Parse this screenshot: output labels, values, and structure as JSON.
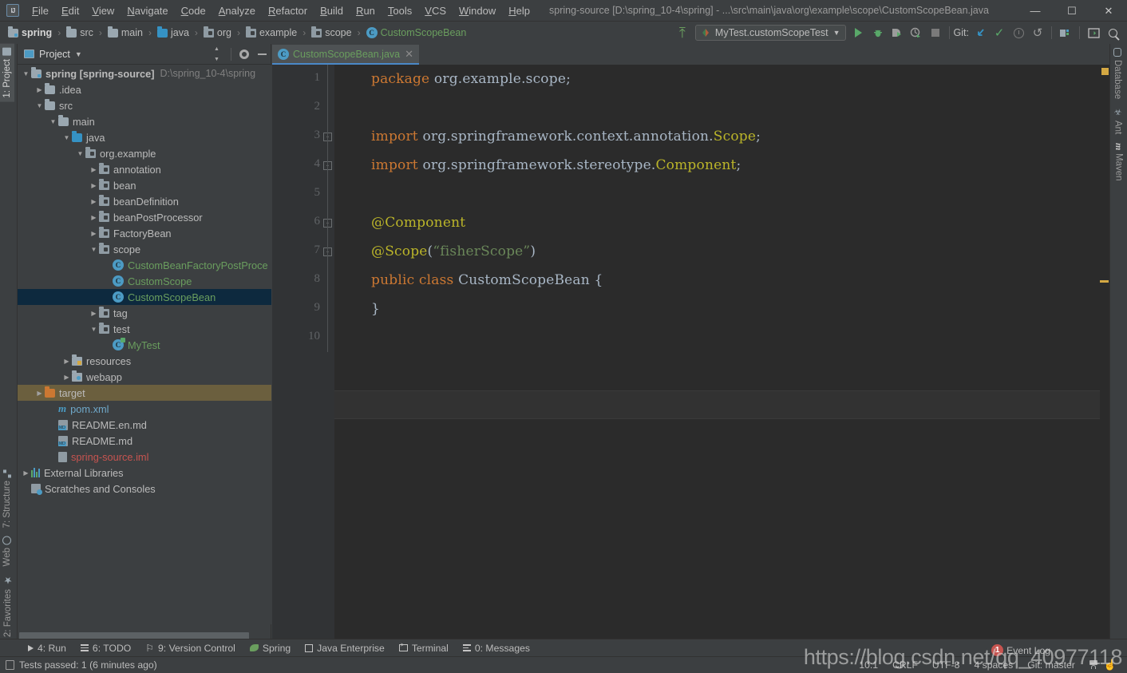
{
  "titlebar": {
    "logo": "IJ",
    "title": "spring-source [D:\\spring_10-4\\spring] - ...\\src\\main\\java\\org\\example\\scope\\CustomScopeBean.java",
    "menus": [
      {
        "label": "File"
      },
      {
        "label": "Edit"
      },
      {
        "label": "View"
      },
      {
        "label": "Navigate"
      },
      {
        "label": "Code"
      },
      {
        "label": "Analyze"
      },
      {
        "label": "Refactor"
      },
      {
        "label": "Build"
      },
      {
        "label": "Run"
      },
      {
        "label": "Tools"
      },
      {
        "label": "VCS"
      },
      {
        "label": "Window"
      },
      {
        "label": "Help"
      }
    ],
    "window_controls": [
      {
        "name": "minimize",
        "glyph": "—"
      },
      {
        "name": "maximize",
        "glyph": "☐"
      },
      {
        "name": "close",
        "glyph": "✕"
      }
    ]
  },
  "navbar": {
    "breadcrumb": [
      {
        "label": "spring",
        "icon": "module-icon",
        "style": "bold"
      },
      {
        "label": "src",
        "icon": "folder-icon",
        "style": "normal"
      },
      {
        "label": "main",
        "icon": "folder-icon",
        "style": "normal"
      },
      {
        "label": "java",
        "icon": "source-folder-icon",
        "style": "normal"
      },
      {
        "label": "org",
        "icon": "package-icon",
        "style": "normal"
      },
      {
        "label": "example",
        "icon": "package-icon",
        "style": "normal"
      },
      {
        "label": "scope",
        "icon": "package-icon",
        "style": "normal"
      },
      {
        "label": "CustomScopeBean",
        "icon": "class-icon",
        "style": "green"
      }
    ],
    "separator": "›",
    "run_config": "MyTest.customScopeTest",
    "git_label": "Git:",
    "toolbar_icons": [
      {
        "name": "update-project-icon"
      },
      {
        "name": "run-icon"
      },
      {
        "name": "debug-icon"
      },
      {
        "name": "run-with-coverage-icon"
      },
      {
        "name": "profile-icon"
      },
      {
        "name": "stop-icon"
      },
      {
        "name": "git-update-icon"
      },
      {
        "name": "git-commit-icon"
      },
      {
        "name": "git-history-icon"
      },
      {
        "name": "git-rollback-icon"
      },
      {
        "name": "project-structure-icon"
      },
      {
        "name": "settings-icon"
      },
      {
        "name": "search-everywhere-icon"
      }
    ]
  },
  "left_stripe": {
    "top": [
      {
        "label": "1: Project",
        "icon": "project-icon",
        "active": true
      }
    ],
    "bottom": [
      {
        "label": "7: Structure",
        "icon": "structure-icon"
      },
      {
        "label": "Web",
        "icon": "web-icon"
      },
      {
        "label": "2: Favorites",
        "icon": "favorites-icon"
      }
    ]
  },
  "right_stripe": {
    "top": [
      {
        "label": "Database",
        "icon": "database-icon"
      },
      {
        "label": "Ant",
        "icon": "ant-icon"
      },
      {
        "label": "Maven",
        "icon": "maven-icon"
      }
    ]
  },
  "project_panel": {
    "title": "Project",
    "dropdown_glyph": "▾",
    "tools": [
      {
        "name": "collapse-all-button"
      },
      {
        "name": "settings-button"
      },
      {
        "name": "hide-button"
      }
    ],
    "tree": [
      {
        "indent": 0,
        "twisty": "▼",
        "icon": "module-icon",
        "label": "spring [spring-source]",
        "bold": true,
        "sub": "D:\\spring_10-4\\spring"
      },
      {
        "indent": 1,
        "twisty": "▶",
        "icon": "folder-icon",
        "label": ".idea"
      },
      {
        "indent": 1,
        "twisty": "▼",
        "icon": "folder-icon",
        "label": "src"
      },
      {
        "indent": 2,
        "twisty": "▼",
        "icon": "folder-icon",
        "label": "main"
      },
      {
        "indent": 3,
        "twisty": "▼",
        "icon": "source-folder-icon",
        "label": "java"
      },
      {
        "indent": 4,
        "twisty": "▼",
        "icon": "package-icon",
        "label": "org.example"
      },
      {
        "indent": 5,
        "twisty": "▶",
        "icon": "package-icon",
        "label": "annotation"
      },
      {
        "indent": 5,
        "twisty": "▶",
        "icon": "package-icon",
        "label": "bean"
      },
      {
        "indent": 5,
        "twisty": "▶",
        "icon": "package-icon",
        "label": "beanDefinition"
      },
      {
        "indent": 5,
        "twisty": "▶",
        "icon": "package-icon",
        "label": "beanPostProcessor"
      },
      {
        "indent": 5,
        "twisty": "▶",
        "icon": "package-icon",
        "label": "FactoryBean"
      },
      {
        "indent": 5,
        "twisty": "▼",
        "icon": "package-icon",
        "label": "scope"
      },
      {
        "indent": 6,
        "twisty": "",
        "icon": "class-icon",
        "label": "CustomBeanFactoryPostProce",
        "color": "green"
      },
      {
        "indent": 6,
        "twisty": "",
        "icon": "class-icon",
        "label": "CustomScope",
        "color": "green"
      },
      {
        "indent": 6,
        "twisty": "",
        "icon": "class-icon",
        "label": "CustomScopeBean",
        "color": "green",
        "selected": true
      },
      {
        "indent": 5,
        "twisty": "▶",
        "icon": "package-icon",
        "label": "tag"
      },
      {
        "indent": 5,
        "twisty": "▼",
        "icon": "package-icon",
        "label": "test"
      },
      {
        "indent": 6,
        "twisty": "",
        "icon": "test-class-icon",
        "label": "MyTest",
        "color": "green"
      },
      {
        "indent": 3,
        "twisty": "▶",
        "icon": "resources-folder-icon",
        "label": "resources"
      },
      {
        "indent": 3,
        "twisty": "▶",
        "icon": "webapp-folder-icon",
        "label": "webapp"
      },
      {
        "indent": 1,
        "twisty": "▶",
        "icon": "excluded-folder-icon",
        "label": "target",
        "highlighted": true
      },
      {
        "indent": 2,
        "twisty": "",
        "icon": "maven-file-icon",
        "label": "pom.xml",
        "color": "blue"
      },
      {
        "indent": 2,
        "twisty": "",
        "icon": "markdown-icon",
        "label": "README.en.md"
      },
      {
        "indent": 2,
        "twisty": "",
        "icon": "markdown-icon",
        "label": "README.md"
      },
      {
        "indent": 2,
        "twisty": "",
        "icon": "iml-file-icon",
        "label": "spring-source.iml",
        "color": "red"
      },
      {
        "indent": 0,
        "twisty": "▶",
        "icon": "libraries-icon",
        "label": "External Libraries"
      },
      {
        "indent": 0,
        "twisty": "",
        "icon": "scratches-icon",
        "label": "Scratches and Consoles"
      }
    ]
  },
  "editor": {
    "tab": {
      "label": "CustomScopeBean.java",
      "icon": "class-icon",
      "close_glyph": "✕"
    },
    "line_numbers": [
      "1",
      "2",
      "3",
      "4",
      "5",
      "6",
      "7",
      "8",
      "9",
      "10"
    ],
    "current_line": 10,
    "caret_position": "10:1",
    "lines": [
      {
        "n": 1,
        "tokens": [
          {
            "t": "package",
            "c": "k"
          },
          {
            "t": " org.example.scope",
            "c": "ident"
          },
          {
            "t": ";",
            "c": "punc"
          }
        ]
      },
      {
        "n": 2,
        "tokens": []
      },
      {
        "n": 3,
        "fold": "-",
        "tokens": [
          {
            "t": "import",
            "c": "k"
          },
          {
            "t": " org.springframework.context.annotation.",
            "c": "ident"
          },
          {
            "t": "Scope",
            "c": "type-y"
          },
          {
            "t": ";",
            "c": "punc"
          }
        ]
      },
      {
        "n": 4,
        "fold": "-",
        "tokens": [
          {
            "t": "import",
            "c": "k"
          },
          {
            "t": " org.springframework.stereotype.",
            "c": "ident"
          },
          {
            "t": "Component",
            "c": "type-y"
          },
          {
            "t": ";",
            "c": "punc"
          }
        ]
      },
      {
        "n": 5,
        "tokens": []
      },
      {
        "n": 6,
        "fold": "-",
        "tokens": [
          {
            "t": "@Component",
            "c": "ann"
          }
        ]
      },
      {
        "n": 7,
        "fold": "-",
        "tokens": [
          {
            "t": "@Scope",
            "c": "ann"
          },
          {
            "t": "(",
            "c": "punc"
          },
          {
            "t": "“fisherScope”",
            "c": "str"
          },
          {
            "t": ")",
            "c": "punc"
          }
        ]
      },
      {
        "n": 8,
        "tokens": [
          {
            "t": "public class ",
            "c": "k"
          },
          {
            "t": "CustomScopeBean",
            "c": "ident"
          },
          {
            "t": " {",
            "c": "punc"
          }
        ]
      },
      {
        "n": 9,
        "tokens": [
          {
            "t": "}",
            "c": "punc"
          }
        ]
      },
      {
        "n": 10,
        "tokens": []
      }
    ]
  },
  "bottom_bar": {
    "items": [
      {
        "label": "4: Run",
        "mnemonic": "4",
        "icon": "run-icon"
      },
      {
        "label": "6: TODO",
        "mnemonic": "6",
        "icon": "todo-icon"
      },
      {
        "label": "9: Version Control",
        "mnemonic": "9",
        "icon": "version-control-icon"
      },
      {
        "label": "Spring",
        "mnemonic": "",
        "icon": "spring-icon"
      },
      {
        "label": "Java Enterprise",
        "mnemonic": "",
        "icon": "java-enterprise-icon"
      },
      {
        "label": "Terminal",
        "mnemonic": "",
        "icon": "terminal-icon"
      },
      {
        "label": "0: Messages",
        "mnemonic": "0",
        "icon": "messages-icon"
      }
    ]
  },
  "status_bar": {
    "message": "Tests passed: 1 (6 minutes ago)",
    "caret": "10:1",
    "line_separator": "CRLF",
    "encoding": "UTF-8",
    "indent": "4 spaces",
    "branch": "Git: master",
    "event_log": {
      "label": "Event Log",
      "badge": "1"
    }
  },
  "watermark": "https://blog.csdn.net/qq_40977118",
  "colors": {
    "accent_blue": "#4a88c7",
    "selection": "#0d293e",
    "editor_bg": "#2b2b2b",
    "panel_bg": "#3c3f41",
    "gutter_bg": "#313335",
    "keyword": "#cc7832",
    "string": "#6a8759",
    "annotation": "#bbb529",
    "identifier": "#a9b7c6",
    "green_text": "#6a9e5e",
    "warning": "#d4a843",
    "error_red": "#c75450"
  }
}
